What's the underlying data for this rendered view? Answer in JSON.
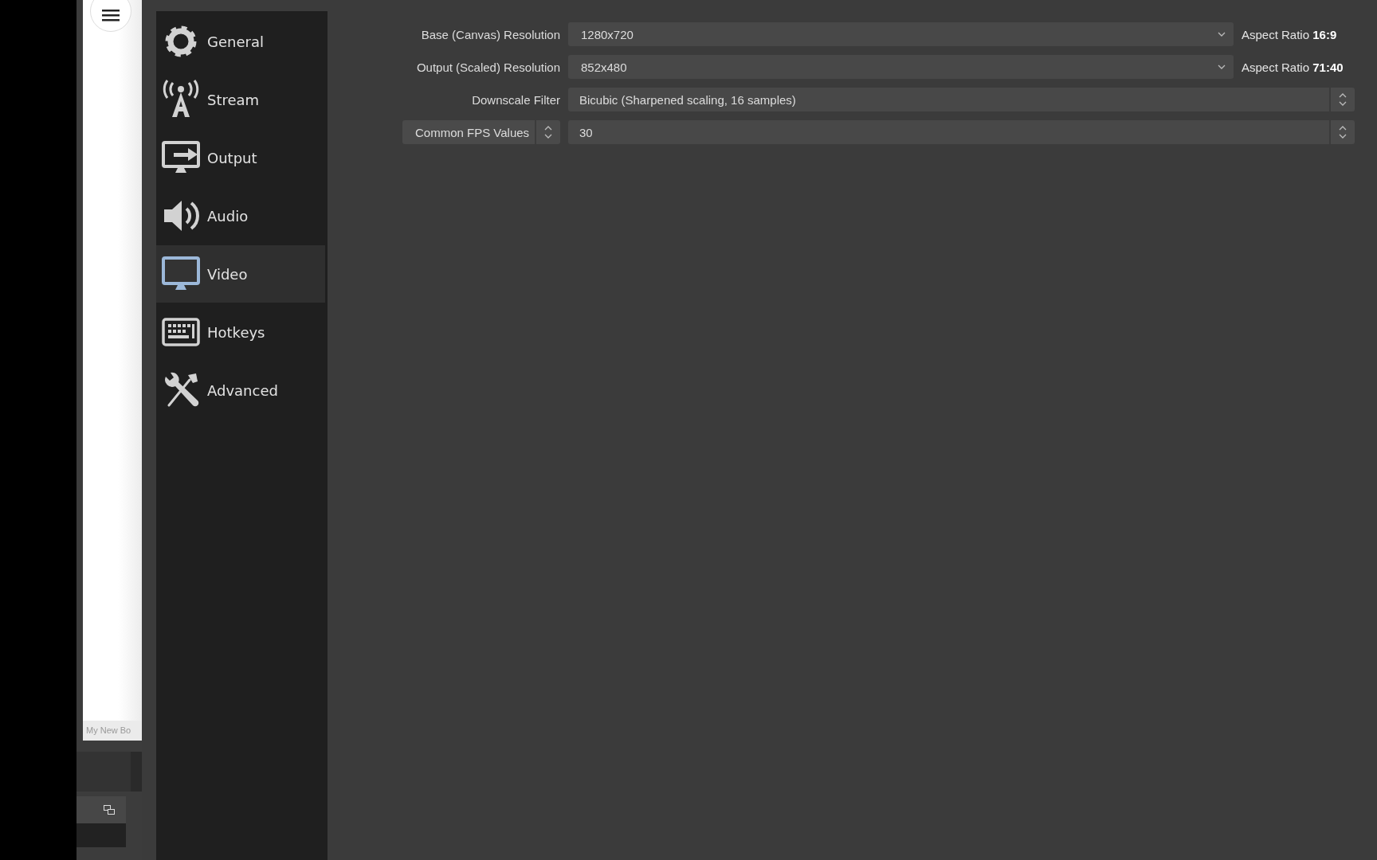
{
  "background_window": {
    "scene_caption": "My New Bo"
  },
  "sidebar": {
    "items": [
      {
        "label": "General",
        "selected": false
      },
      {
        "label": "Stream",
        "selected": false
      },
      {
        "label": "Output",
        "selected": false
      },
      {
        "label": "Audio",
        "selected": false
      },
      {
        "label": "Video",
        "selected": true
      },
      {
        "label": "Hotkeys",
        "selected": false
      },
      {
        "label": "Advanced",
        "selected": false
      }
    ]
  },
  "video_settings": {
    "rows": [
      {
        "kind": "dropdown",
        "label": "Base (Canvas) Resolution",
        "value": "1280x720",
        "note": "Aspect Ratio **16:9**"
      },
      {
        "kind": "dropdown",
        "label": "Output (Scaled) Resolution",
        "value": "852x480",
        "note": "Aspect Ratio **71:40**"
      },
      {
        "kind": "spin",
        "label": "Downscale Filter",
        "value": "Bicubic (Sharpened scaling, 16 samples)"
      },
      {
        "kind": "fps",
        "label": "Common FPS Values",
        "value": "30"
      }
    ]
  }
}
